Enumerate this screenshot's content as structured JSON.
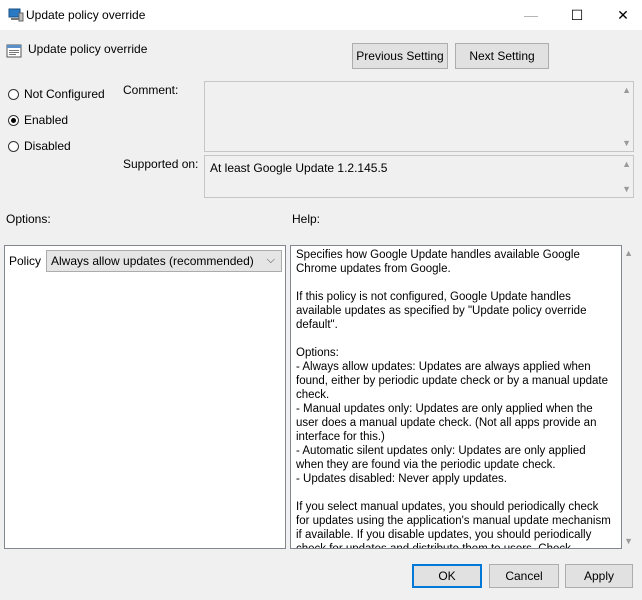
{
  "window": {
    "title": "Update policy override",
    "minimize": "—",
    "maximize": "☐",
    "close": "✕"
  },
  "header": {
    "title": "Update policy override",
    "prev_label": "Previous Setting",
    "next_label": "Next Setting"
  },
  "state": {
    "options": [
      {
        "label": "Not Configured",
        "selected": false
      },
      {
        "label": "Enabled",
        "selected": true
      },
      {
        "label": "Disabled",
        "selected": false
      }
    ]
  },
  "comment": {
    "label": "Comment:",
    "value": ""
  },
  "supported": {
    "label": "Supported on:",
    "value": "At least Google Update 1.2.145.5"
  },
  "options_section": {
    "label": "Options:",
    "policy_label": "Policy",
    "policy_value": "Always allow updates (recommended)"
  },
  "help": {
    "label": "Help:",
    "paragraphs": [
      "Specifies how Google Update handles available Google Chrome updates from Google.",
      "If this policy is not configured, Google Update handles available updates as specified by \"Update policy override default\".",
      "Options:\n - Always allow updates: Updates are always applied when found, either by periodic update check or by a manual update check.\n - Manual updates only: Updates are only applied when the user does a manual update check. (Not all apps provide an interface for this.)\n - Automatic silent updates only: Updates are only applied when they are found via the periodic update check.\n - Updates disabled: Never apply updates.",
      "If you select manual updates, you should periodically check for updates using the application's manual update mechanism if available. If you disable updates, you should periodically check for updates and distribute them to users. Check https://www.google.com/chrome/."
    ]
  },
  "footer": {
    "ok": "OK",
    "cancel": "Cancel",
    "apply": "Apply"
  }
}
